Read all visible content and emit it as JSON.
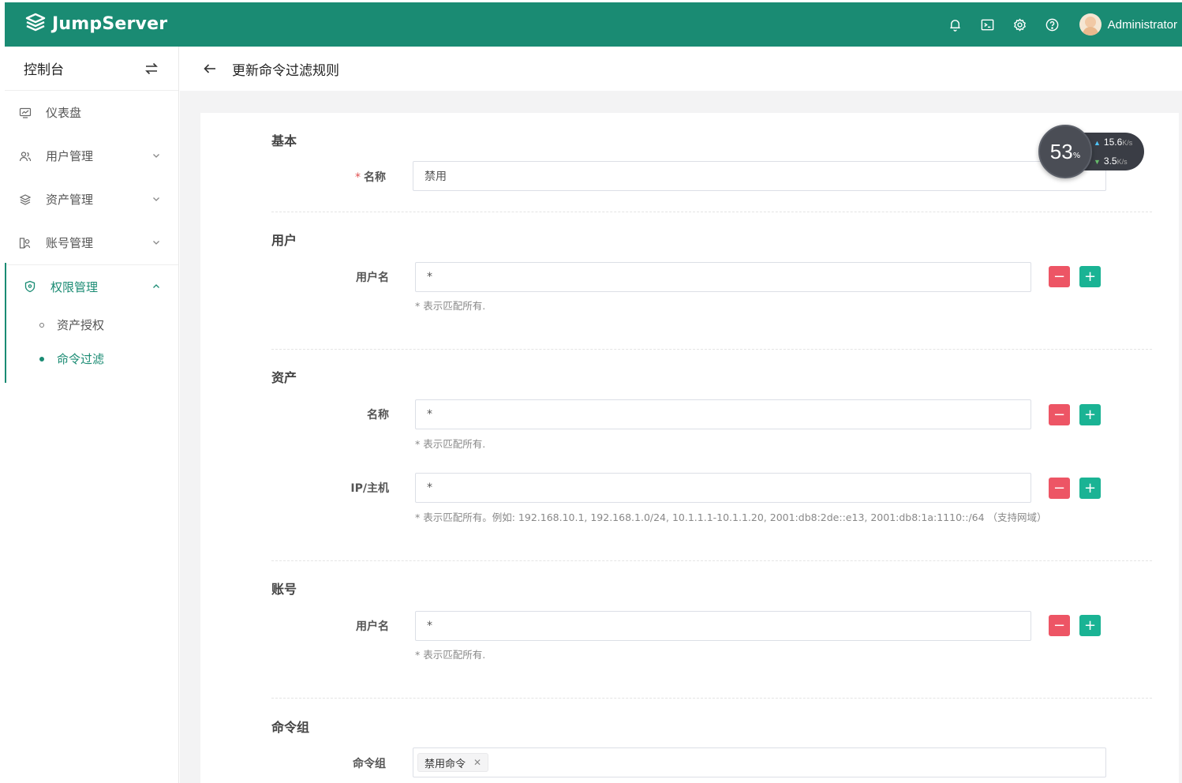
{
  "header": {
    "brand": "JumpServer",
    "icons": [
      "bell-icon",
      "terminal-icon",
      "gear-icon",
      "help-icon"
    ],
    "user_name": "Administrator",
    "bg_color": "#1a8b73"
  },
  "sidebar": {
    "console_title": "控制台",
    "items": [
      {
        "label": "仪表盘",
        "icon": "dashboard-icon"
      },
      {
        "label": "用户管理",
        "icon": "users-icon"
      },
      {
        "label": "资产管理",
        "icon": "assets-icon"
      },
      {
        "label": "账号管理",
        "icon": "accounts-icon"
      },
      {
        "label": "权限管理",
        "icon": "shield-icon"
      }
    ],
    "sub_items": [
      {
        "label": "资产授权"
      },
      {
        "label": "命令过滤"
      }
    ]
  },
  "page": {
    "title": "更新命令过滤规则"
  },
  "form": {
    "basic": {
      "title": "基本",
      "name_label": "名称",
      "name_value": "禁用"
    },
    "users": {
      "title": "用户",
      "username_label": "用户名",
      "username_value": "*",
      "hint": "* 表示匹配所有."
    },
    "assets": {
      "title": "资产",
      "name_label": "名称",
      "name_value": "*",
      "name_hint": "* 表示匹配所有.",
      "ip_label": "IP/主机",
      "ip_value": "*",
      "ip_hint": "* 表示匹配所有。例如: 192.168.10.1, 192.168.1.0/24, 10.1.1.1-10.1.1.20, 2001:db8:2de::e13, 2001:db8:1a:1110::/64 （支持网域）"
    },
    "accounts": {
      "title": "账号",
      "username_label": "用户名",
      "username_value": "*",
      "hint": "* 表示匹配所有."
    },
    "command_groups": {
      "title": "命令组",
      "label": "命令组",
      "tags": [
        "禁用命令"
      ]
    },
    "buttons": {
      "minus": "−",
      "plus": "+"
    }
  },
  "speed_widget": {
    "percent": "53",
    "percent_unit": "%",
    "upload": "15.6",
    "download": "3.5",
    "rate_unit": "K/s"
  }
}
